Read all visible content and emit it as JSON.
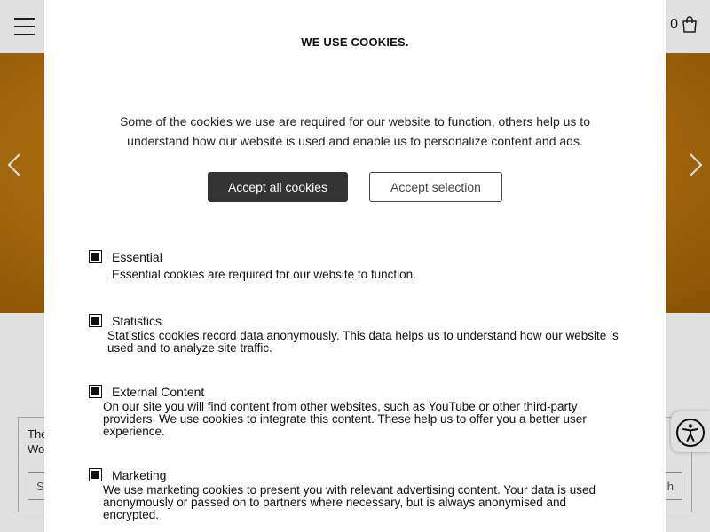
{
  "header": {
    "cart_count": "0"
  },
  "notice": {
    "text": "The Wo",
    "input_placeholder": "S",
    "button_label": "h"
  },
  "cookie_modal": {
    "title": "WE USE COOKIES.",
    "description": "Some of the cookies we use are required for our website to function, others help us to understand how our website is used and enable us to personalize content and ads.",
    "accept_all_label": "Accept all cookies",
    "accept_selection_label": "Accept selection",
    "options": [
      {
        "label": "Essential",
        "description": "Essential cookies are required for our website to function.",
        "checked": true
      },
      {
        "label": "Statistics",
        "description": "Statistics cookies record data anonymously. This data helps us to understand how our website is used and to analyze site traffic.",
        "checked": true
      },
      {
        "label": "External Content",
        "description": "On our site you will find content from other websites, such as YouTube or other third-party providers. We use cookies to integrate this content. These help us to offer you a better user experience.",
        "checked": true
      },
      {
        "label": "Marketing",
        "description": "We use marketing cookies to present you with relevant advertising content. Your data is used anonymously or passed on to partners where necessary, but is always anonymised and encrypted.",
        "checked": true
      }
    ]
  },
  "colors": {
    "hero": "#c07d12",
    "primary_button": "#333333"
  },
  "icons": [
    "hamburger-menu-icon",
    "shopping-bag-icon",
    "chevron-left-icon",
    "chevron-right-icon",
    "accessibility-icon"
  ]
}
